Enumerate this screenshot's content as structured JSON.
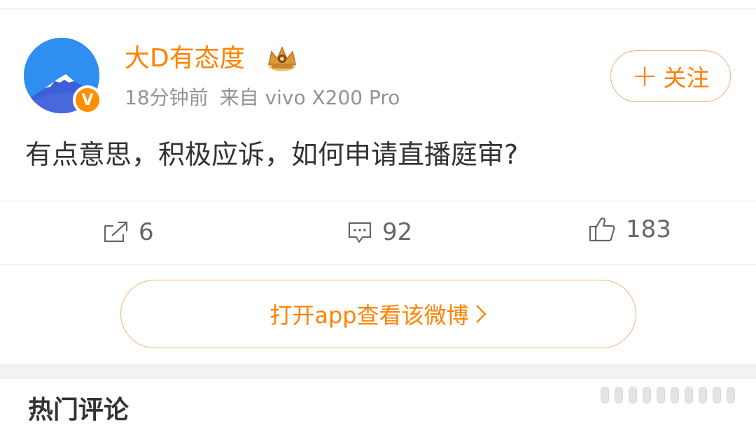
{
  "post": {
    "author": "大D有态度",
    "time_ago": "18分钟前",
    "source": "来自 vivo X200 Pro",
    "text": "有点意思，积极应诉，如何申请直播庭审?"
  },
  "follow_button": {
    "plus": "+",
    "label": "关注"
  },
  "actions": {
    "repost_count": "6",
    "comment_count": "92",
    "like_count": "183"
  },
  "open_app_button": {
    "label": "打开app查看该微博"
  },
  "next_section": {
    "title": "热门评论"
  },
  "icons": {
    "avatar": "mountain-avatar",
    "verify_badge": "V",
    "crown": "crown-icon",
    "repost": "share-icon",
    "comment": "comment-icon",
    "like": "thumbs-up-icon",
    "chevron": "chevron-right-icon"
  },
  "colors": {
    "brand_orange": "#ff8200",
    "avatar_blue": "#2f8ff0",
    "text_primary": "#333333",
    "text_meta": "#939393",
    "text_actions": "#666666"
  }
}
